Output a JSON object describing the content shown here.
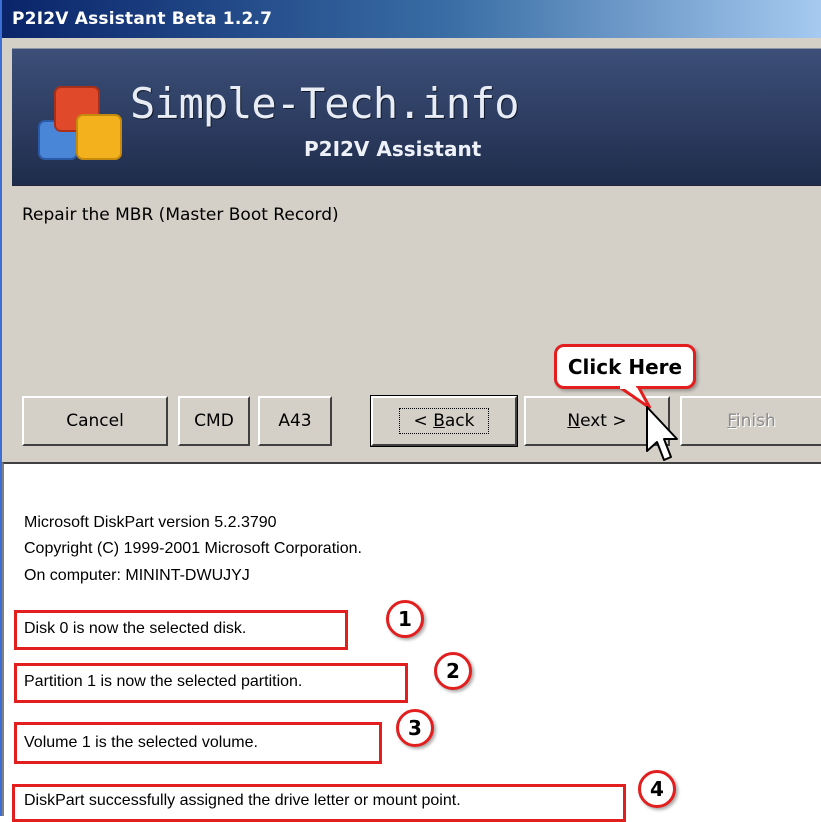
{
  "window": {
    "title": "P2I2V Assistant Beta 1.2.7"
  },
  "banner": {
    "brand": "Simple-Tech.info",
    "product": "P2I2V Assistant",
    "logo_icon": "stacked-squares-logo-icon"
  },
  "step_text": "Repair the MBR (Master Boot Record)",
  "buttons": {
    "cancel": "Cancel",
    "cmd": "CMD",
    "a43": "A43",
    "back_prefix": "< ",
    "back_accel": "B",
    "back_rest": "ack",
    "next_accel": "N",
    "next_rest": "ext >",
    "finish_accel": "F",
    "finish_rest": "inish"
  },
  "callout": {
    "label": "Click Here",
    "color": "#e21e1e"
  },
  "console": {
    "lines": [
      "Microsoft DiskPart version 5.2.3790",
      "Copyright (C) 1999-2001 Microsoft Corporation.",
      "On computer: MININT-DWUJYJ"
    ],
    "highlighted": [
      {
        "text": "Disk 0 is now the selected disk.",
        "badge": "1"
      },
      {
        "text": "Partition 1 is now the selected partition.",
        "badge": "2"
      },
      {
        "text": "Volume 1 is the selected volume.",
        "badge": "3"
      },
      {
        "text": "DiskPart successfully assigned the drive letter or mount point.",
        "badge": "4"
      }
    ]
  }
}
